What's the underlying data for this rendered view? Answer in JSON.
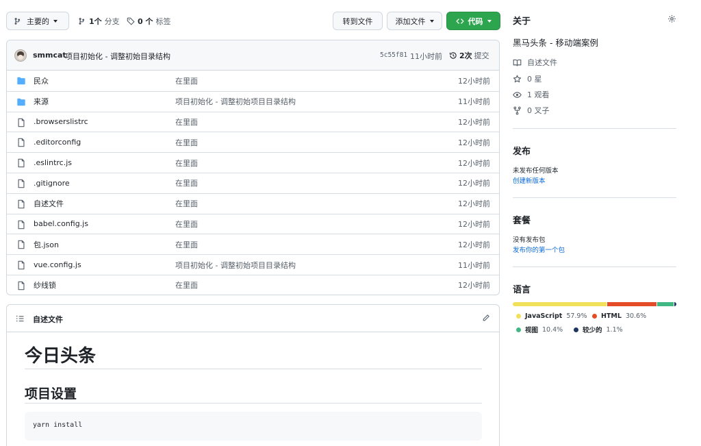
{
  "toolbar": {
    "branch_label": "主要的",
    "branches_count": "1个",
    "branches_label": "分支",
    "tags_count": "0 个",
    "tags_label": "标签",
    "goto_file": "转到文件",
    "add_file": "添加文件",
    "code": "代码"
  },
  "commit": {
    "author": "smmcat",
    "message": "项目初始化 - 调整初始目录结构",
    "hash": "5c55f81",
    "time": "11小时前",
    "commits_count": "2次",
    "commits_label": "提交"
  },
  "files": [
    {
      "name": "民众",
      "type": "folder",
      "message": "在里面",
      "age": "12小时前"
    },
    {
      "name": "来源",
      "type": "folder",
      "message": "项目初始化 - 调整初始项目目录结构",
      "age": "11小时前"
    },
    {
      "name": ".browserslistrc",
      "type": "file",
      "message": "在里面",
      "age": "12小时前"
    },
    {
      "name": ".editorconfig",
      "type": "file",
      "message": "在里面",
      "age": "12小时前"
    },
    {
      "name": ".eslintrc.js",
      "type": "file",
      "message": "在里面",
      "age": "12小时前"
    },
    {
      "name": ".gitignore",
      "type": "file",
      "message": "在里面",
      "age": "12小时前"
    },
    {
      "name": "自述文件",
      "type": "file",
      "message": "在里面",
      "age": "12小时前"
    },
    {
      "name": "babel.config.js",
      "type": "file",
      "message": "在里面",
      "age": "12小时前"
    },
    {
      "name": "包.json",
      "type": "file",
      "message": "在里面",
      "age": "12小时前"
    },
    {
      "name": "vue.config.js",
      "type": "file",
      "message": "项目初始化 - 调整初始项目目录结构",
      "age": "11小时前"
    },
    {
      "name": "纱线锁",
      "type": "file",
      "message": "在里面",
      "age": "12小时前"
    }
  ],
  "readme": {
    "header": "自述文件",
    "h1": "今日头条",
    "h2": "项目设置",
    "code": "yarn install"
  },
  "about": {
    "title": "关于",
    "description": "黑马头条 - 移动端案例",
    "readme": "自述文件",
    "stars": "0 星",
    "watchers": "1 观看",
    "forks": "0 叉子"
  },
  "releases": {
    "title": "发布",
    "none": "未发布任何版本",
    "create": "创建新版本"
  },
  "packages": {
    "title": "套餐",
    "none": "没有发布包",
    "publish": "发布你的第一个包"
  },
  "languages": {
    "title": "语言",
    "items": [
      {
        "name": "JavaScript",
        "percent": "57.9%",
        "value": 57.9,
        "color": "#f1e05a"
      },
      {
        "name": "HTML",
        "percent": "30.6%",
        "value": 30.6,
        "color": "#e34c26"
      },
      {
        "name": "视图",
        "percent": "10.4%",
        "value": 10.4,
        "color": "#41b883"
      },
      {
        "name": "较少的",
        "percent": "1.1%",
        "value": 1.1,
        "color": "#1d365d"
      }
    ]
  },
  "colors": {
    "accent_green": "#2da44e",
    "link_blue": "#0969da",
    "folder_blue": "#54aeff"
  }
}
